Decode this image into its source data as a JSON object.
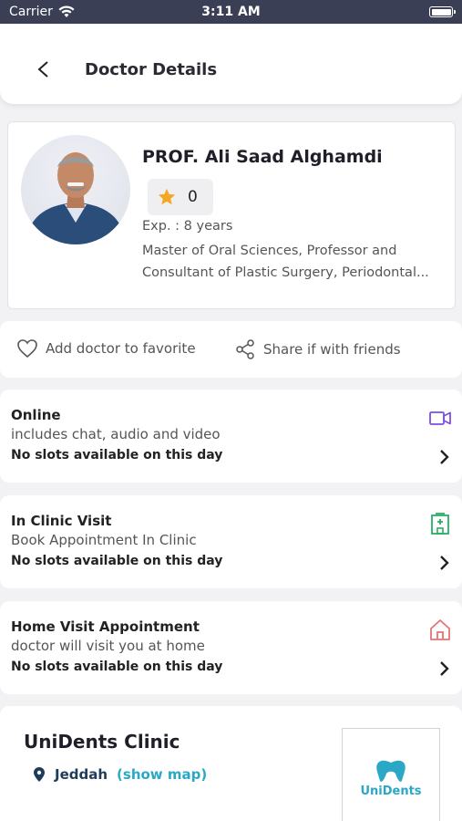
{
  "status_bar": {
    "carrier": "Carrier",
    "time": "3:11 AM"
  },
  "header": {
    "title": "Doctor Details"
  },
  "doctor": {
    "name": "PROF. Ali Saad Alghamdi",
    "rating": "0",
    "experience": "Exp. : 8 years",
    "description_line1": "Master of Oral Sciences, Professor and",
    "description_line2": "Consultant of Plastic Surgery, Periodontal..."
  },
  "actions": {
    "favorite": "Add doctor to favorite",
    "share": "Share if with friends"
  },
  "visits": [
    {
      "title": "Online",
      "subtitle": "includes chat, audio and video",
      "status": "No slots available on this day",
      "icon": "video-icon",
      "color": "#7b4fe0"
    },
    {
      "title": "In Clinic Visit",
      "subtitle": "Book Appointment In Clinic",
      "status": "No slots available on this day",
      "icon": "hospital-icon",
      "color": "#27ae60"
    },
    {
      "title": "Home Visit Appointment",
      "subtitle": "doctor will visit you at home",
      "status": "No slots available on this day",
      "icon": "home-icon",
      "color": "#e57373"
    }
  ],
  "clinic": {
    "name": "UniDents Clinic",
    "city": "Jeddah",
    "show_map": "(show map)",
    "logo_text": "UniDents"
  },
  "colors": {
    "accent": "#2aa8c6",
    "star": "#f5a623",
    "status_bar": "#3a3f55"
  }
}
